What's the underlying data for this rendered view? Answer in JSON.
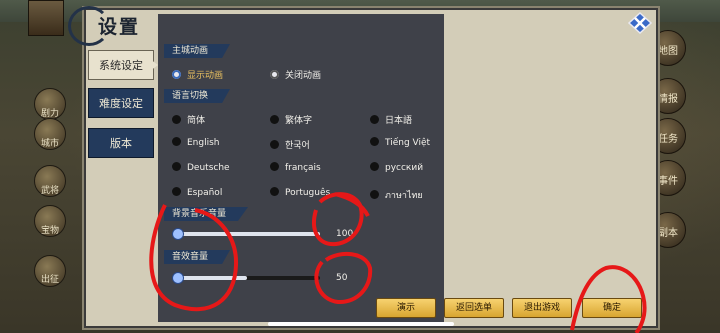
{
  "title": "设置",
  "tabs": [
    {
      "label": "系统设定",
      "active": true
    },
    {
      "label": "难度设定",
      "active": false
    },
    {
      "label": "版本",
      "active": false
    }
  ],
  "sections": {
    "main_city_animation": "主城动画",
    "language": "语言切换",
    "bgm_volume": "背景音乐音量",
    "sfx_volume": "音效音量"
  },
  "animation_options": [
    {
      "label": "显示动画",
      "selected": true
    },
    {
      "label": "关闭动画",
      "selected": false
    }
  ],
  "languages": [
    "简体",
    "繁体字",
    "日本語",
    "English",
    "한국어",
    "Tiếng Việt",
    "Deutsche",
    "français",
    "русский",
    "Español",
    "Português",
    "ภาษาไทย"
  ],
  "bgm": {
    "value": "100",
    "fraction": 1.0
  },
  "sfx": {
    "value": "50",
    "fraction": 0.5
  },
  "buttons": {
    "demo": "演示",
    "back": "返回选单",
    "exit": "退出游戏",
    "confirm": "确定"
  },
  "left_menu": [
    "剧力",
    "城市",
    "武将",
    "宝物",
    "出征"
  ],
  "right_menu": [
    "地图",
    "情报",
    "任务",
    "事件",
    "副本"
  ],
  "colors": {
    "annotation": "#e61818",
    "tab_active": "#e8e2ce",
    "tab_inactive": "#233a5c",
    "button": "#f0c458"
  }
}
